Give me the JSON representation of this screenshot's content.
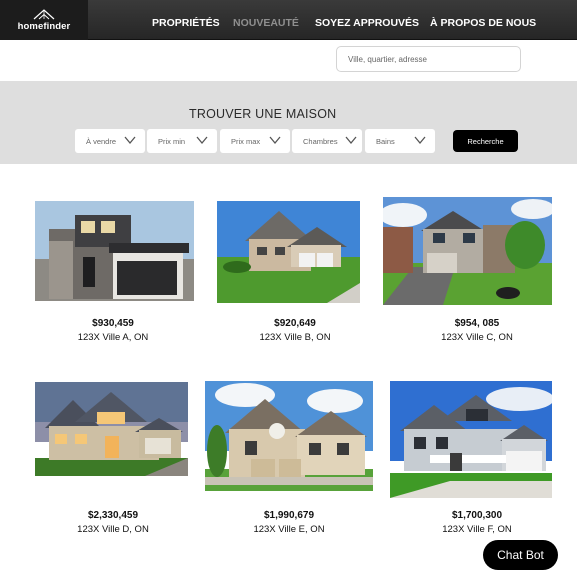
{
  "brand": {
    "name": "homefinder"
  },
  "nav": {
    "items": [
      {
        "label": "PROPRIÉTÉS",
        "active": false
      },
      {
        "label": "NOUVEAUTÉ",
        "active": true
      },
      {
        "label": "SOYEZ APPROUVÉS",
        "active": false
      },
      {
        "label": "À PROPOS DE NOUS",
        "active": false
      }
    ]
  },
  "search": {
    "placeholder": "Ville, quartier, adresse"
  },
  "filters": {
    "title": "TROUVER UNE MAISON",
    "dropdowns": [
      {
        "label": "À vendre"
      },
      {
        "label": "Prix min"
      },
      {
        "label": "Prix max"
      },
      {
        "label": "Chambres"
      },
      {
        "label": "Bains"
      }
    ],
    "search_button": "Recherche"
  },
  "listings": [
    {
      "price": "$930,459",
      "address": "123X Ville A, ON"
    },
    {
      "price": "$920,649",
      "address": "123X Ville B, ON"
    },
    {
      "price": "$954, 085",
      "address": "123X Ville C, ON"
    },
    {
      "price": "$2,330,459",
      "address": "123X Ville D, ON"
    },
    {
      "price": "$1,990,679",
      "address": "123X Ville E, ON"
    },
    {
      "price": "$1,700,300",
      "address": "123X Ville F, ON"
    }
  ],
  "chatbot": {
    "label": "Chat Bot"
  },
  "colors": {
    "nav_bg": "#2c2c2c",
    "filter_bg": "#dedede",
    "button": "#000000",
    "active_nav": "#8f8f8f"
  }
}
